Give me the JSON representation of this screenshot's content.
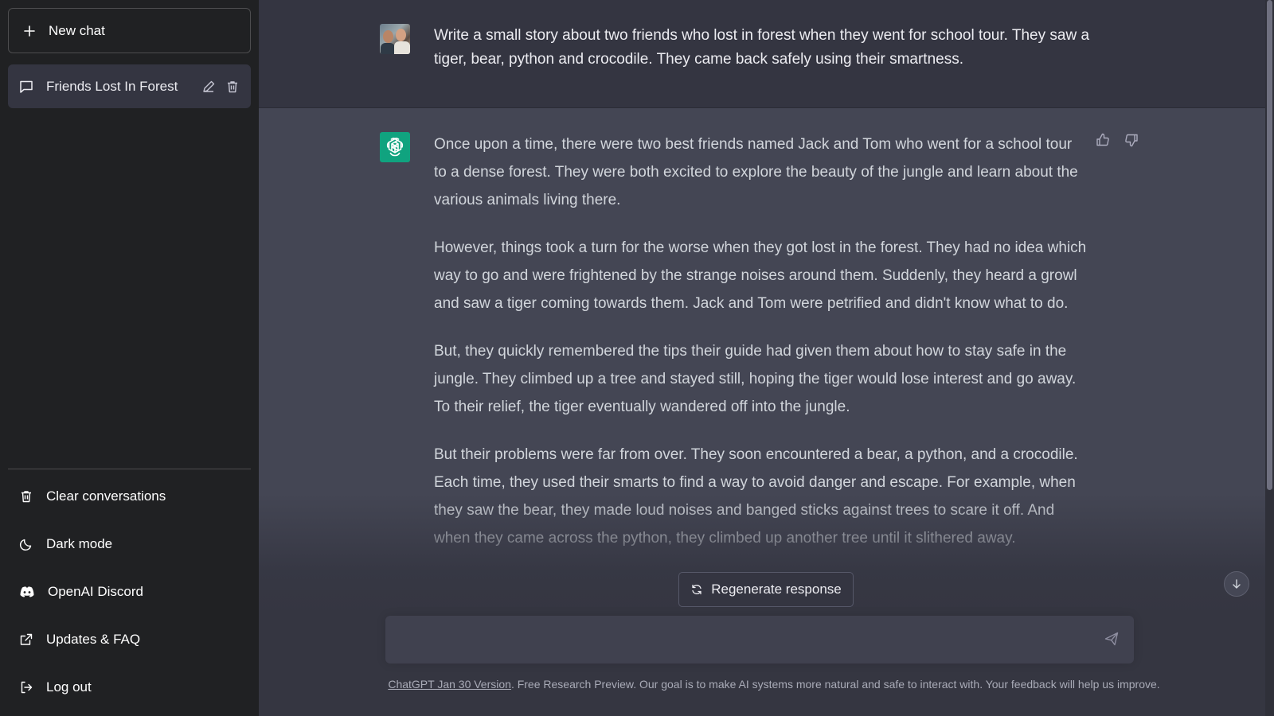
{
  "sidebar": {
    "new_chat_label": "New chat",
    "conversations": [
      {
        "label": "Friends Lost In Forest"
      }
    ],
    "bottom_items": [
      {
        "label": "Clear conversations",
        "icon": "trash-icon"
      },
      {
        "label": "Dark mode",
        "icon": "moon-icon"
      },
      {
        "label": "OpenAI Discord",
        "icon": "discord-icon"
      },
      {
        "label": "Updates & FAQ",
        "icon": "external-link-icon"
      },
      {
        "label": "Log out",
        "icon": "logout-icon"
      }
    ]
  },
  "chat": {
    "user_message": "Write a small story about two friends who lost in forest when they went for school tour. They saw a tiger, bear, python and crocodile. They came back safely using their smartness.",
    "assistant_paragraphs": [
      "Once upon a time, there were two best friends named Jack and Tom who went for a school tour to a dense forest. They were both excited to explore the beauty of the jungle and learn about the various animals living there.",
      "However, things took a turn for the worse when they got lost in the forest. They had no idea which way to go and were frightened by the strange noises around them. Suddenly, they heard a growl and saw a tiger coming towards them. Jack and Tom were petrified and didn't know what to do.",
      "But, they quickly remembered the tips their guide had given them about how to stay safe in the jungle. They climbed up a tree and stayed still, hoping the tiger would lose interest and go away. To their relief, the tiger eventually wandered off into the jungle.",
      "But their problems were far from over. They soon encountered a bear, a python, and a crocodile. Each time, they used their smarts to find a way to avoid danger and escape. For example, when they saw the bear, they made loud noises and banged sticks against trees to scare it off. And when they came across the python, they climbed up another tree until it slithered away."
    ]
  },
  "controls": {
    "regenerate_label": "Regenerate response",
    "input_value": "",
    "input_placeholder": ""
  },
  "footer": {
    "version_link": "ChatGPT Jan 30 Version",
    "text": ". Free Research Preview. Our goal is to make AI systems more natural and safe to interact with. Your feedback will help us improve."
  },
  "colors": {
    "sidebar_bg": "#202123",
    "main_bg": "#343541",
    "assistant_bg": "#444654",
    "brand_green": "#10a37f"
  }
}
